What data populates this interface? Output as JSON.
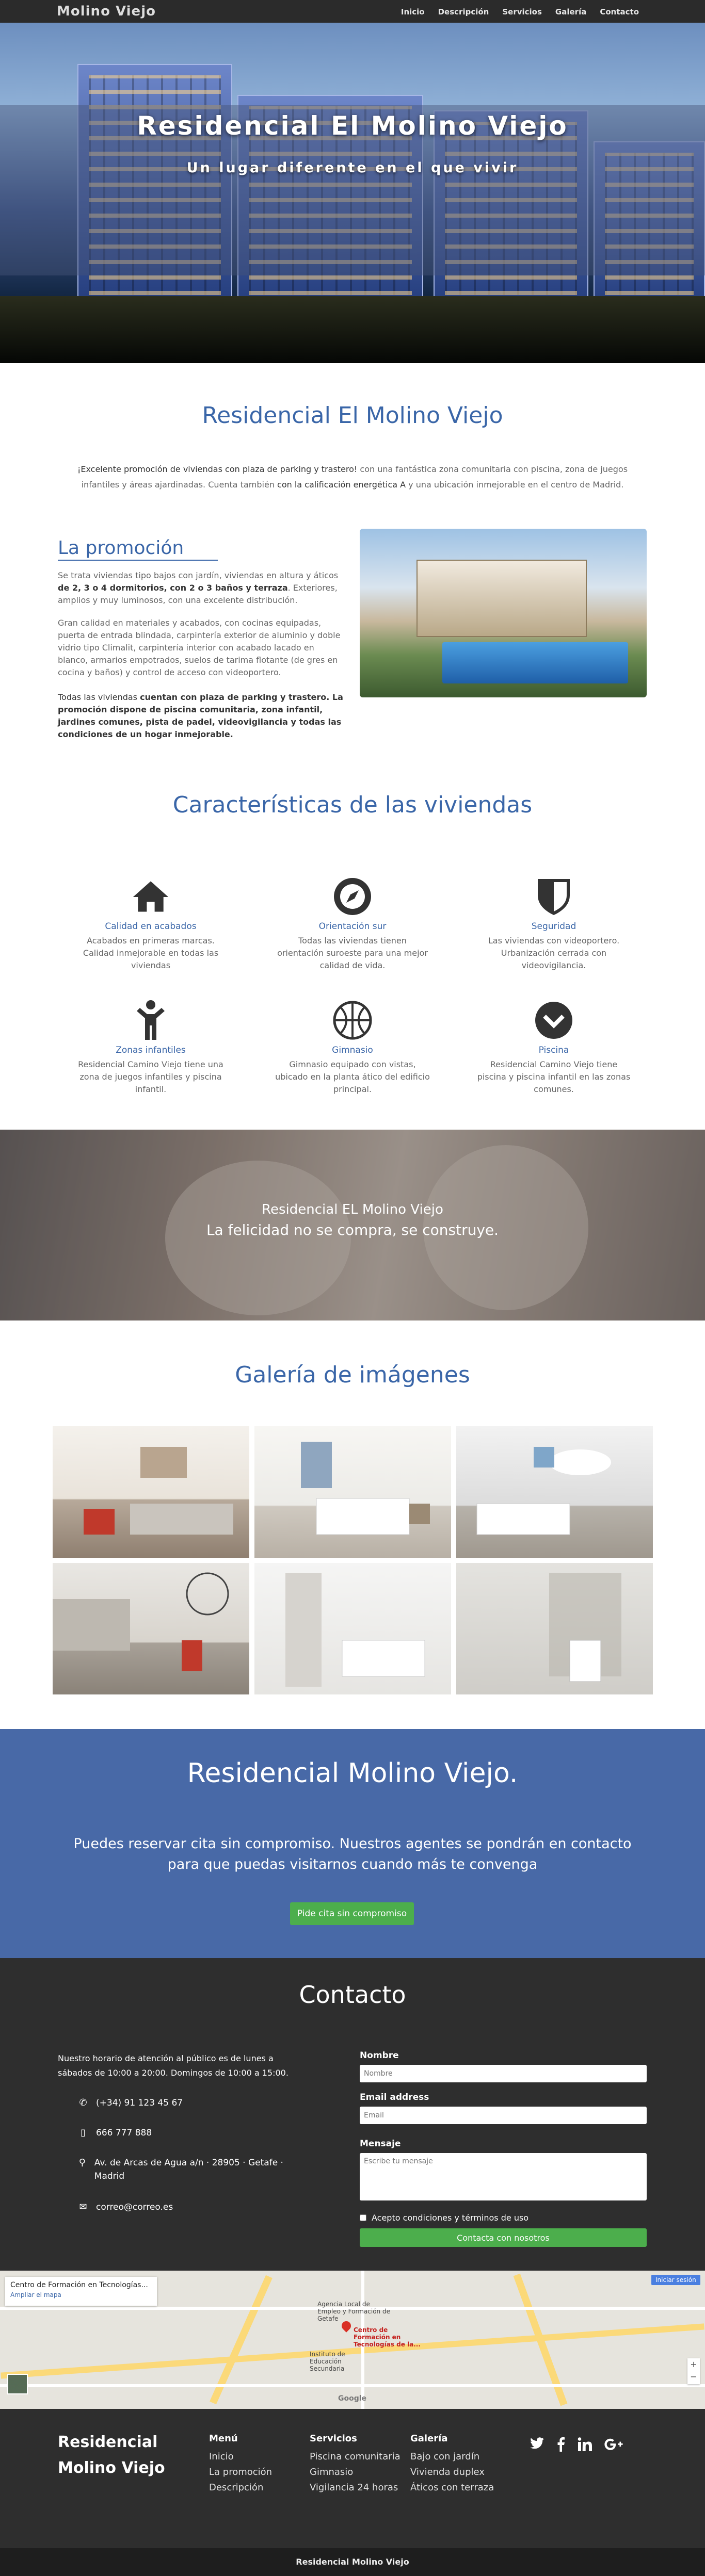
{
  "nav": {
    "brand": "Molino Viejo",
    "items": [
      "Inicio",
      "Descripción",
      "Servicios",
      "Galería",
      "Contacto"
    ]
  },
  "hero": {
    "title": "Residencial El Molino Viejo",
    "subtitle": "Un lugar diferente en el que vivir"
  },
  "intro": {
    "title": "Residencial El Molino Viejo",
    "text_1": "¡Excelente promoción de viviendas con plaza de parking y trastero!",
    "text_2": " con una fantástica zona comunitaria con piscina, zona de juegos infantiles y áreas ajardinadas. Cuenta también ",
    "text_3": "con la calificación energética A",
    "text_4": " y una ubicación inmejorable en el centro de Madrid."
  },
  "promo": {
    "title": "La promoción",
    "p1_a": "Se trata viviendas tipo bajos con jardín, viviendas en altura y áticos ",
    "p1_b": "de 2, 3 o 4 dormitorios, con 2 o 3 baños y terraza",
    "p1_c": ". Exteriores, amplios y muy luminosos, con una excelente distribución.",
    "p2": "Gran calidad en materiales y acabados, con cocinas equipadas, puerta de entrada blindada, carpintería exterior de aluminio y doble vidrio tipo Climalit, carpintería interior con acabado lacado en blanco, armarios empotrados, suelos de tarima flotante (de gres en cocina y baños) y control de acceso con videoportero.",
    "p3_a": "Todas las viviendas ",
    "p3_b": "cuentan con plaza de parking y trastero. La promoción dispone de piscina comunitaria, zona infantil, jardines comunes, pista de padel, videovigilancia y todas las condiciones de un hogar inmejorable."
  },
  "features": {
    "title": "Características de las viviendas",
    "items": [
      {
        "icon": "home-icon",
        "title": "Calidad en acabados",
        "desc": "Acabados en primeras marcas. Calidad inmejorable en todas las viviendas"
      },
      {
        "icon": "compass-icon",
        "title": "Orientación sur",
        "desc": "Todas las viviendas tienen orientación suroeste para una mejor calidad de vida."
      },
      {
        "icon": "shield-icon",
        "title": "Seguridad",
        "desc": "Las viviendas con videoportero. Urbanización cerrada con videovigilancia."
      },
      {
        "icon": "child-icon",
        "title": "Zonas infantiles",
        "desc": "Residencial Camino Viejo tiene una zona de juegos infantiles y piscina infantil."
      },
      {
        "icon": "basketball-icon",
        "title": "Gimnasio",
        "desc": "Gimnasio equipado con vistas, ubicado en la planta ático del edificio principal."
      },
      {
        "icon": "chevron-circle-icon",
        "title": "Piscina",
        "desc": "Residencial Camino Viejo tiene piscina y piscina infantil en las zonas comunes."
      }
    ]
  },
  "quote": {
    "line1": "Residencial EL Molino Viejo",
    "line2": "La felicidad no se compra, se construye."
  },
  "gallery": {
    "title": "Galería de imágenes",
    "images": [
      "living-room",
      "bedroom",
      "kids-room",
      "kitchen",
      "bathroom",
      "shower"
    ]
  },
  "cta": {
    "title": "Residencial Molino Viejo.",
    "text": "Puedes reservar cita sin compromiso. Nuestros agentes se pondrán en contacto para que puedas visitarnos cuando más te convenga",
    "button": "Pide cita sin compromiso"
  },
  "contact": {
    "title": "Contacto",
    "hours": "Nuestro horario de atención al público es de lunes a sábados de 10:00 a 20:00. Domingos de 10:00 a 15:00.",
    "phone": "(+34) 91 123 45 67",
    "mobile": "666 777 888",
    "address": "Av. de Arcas de Agua a/n · 28905 · Getafe · Madrid",
    "email": "correo@correo.es",
    "form": {
      "name_label": "Nombre",
      "name_placeholder": "Nombre",
      "email_label": "Email address",
      "email_placeholder": "Email",
      "message_label": "Mensaje",
      "message_placeholder": "Escribe tu mensaje",
      "terms": "Acepto condiciones y términos de uso",
      "submit": "Contacta con nosotros"
    }
  },
  "map": {
    "card_title": "Centro de Formación en Tecnologías...",
    "card_link": "Ampliar el mapa",
    "badge": "Iniciar sesión",
    "pin1": "Agencia Local de Empleo y Formación de Getafe",
    "pin2": "Centro de Formación en Tecnologías de la...",
    "pin3": "Instituto de Educación Secundaria",
    "brand": "Google"
  },
  "footer": {
    "brand": "Residencial Molino Viejo",
    "cols": [
      {
        "heading": "Menú",
        "links": [
          "Inicio",
          "La promoción",
          "Descripción"
        ]
      },
      {
        "heading": "Servicios",
        "links": [
          "Piscina comunitaria",
          "Gimnasio",
          "Vigilancia 24 horas"
        ]
      },
      {
        "heading": "Galería",
        "links": [
          "Bajo con jardín",
          "Vivienda duplex",
          "Áticos con terraza"
        ]
      }
    ],
    "social": [
      "twitter-icon",
      "facebook-icon",
      "linkedin-icon",
      "googleplus-icon"
    ],
    "bottom": "Residencial Molino Viejo"
  }
}
